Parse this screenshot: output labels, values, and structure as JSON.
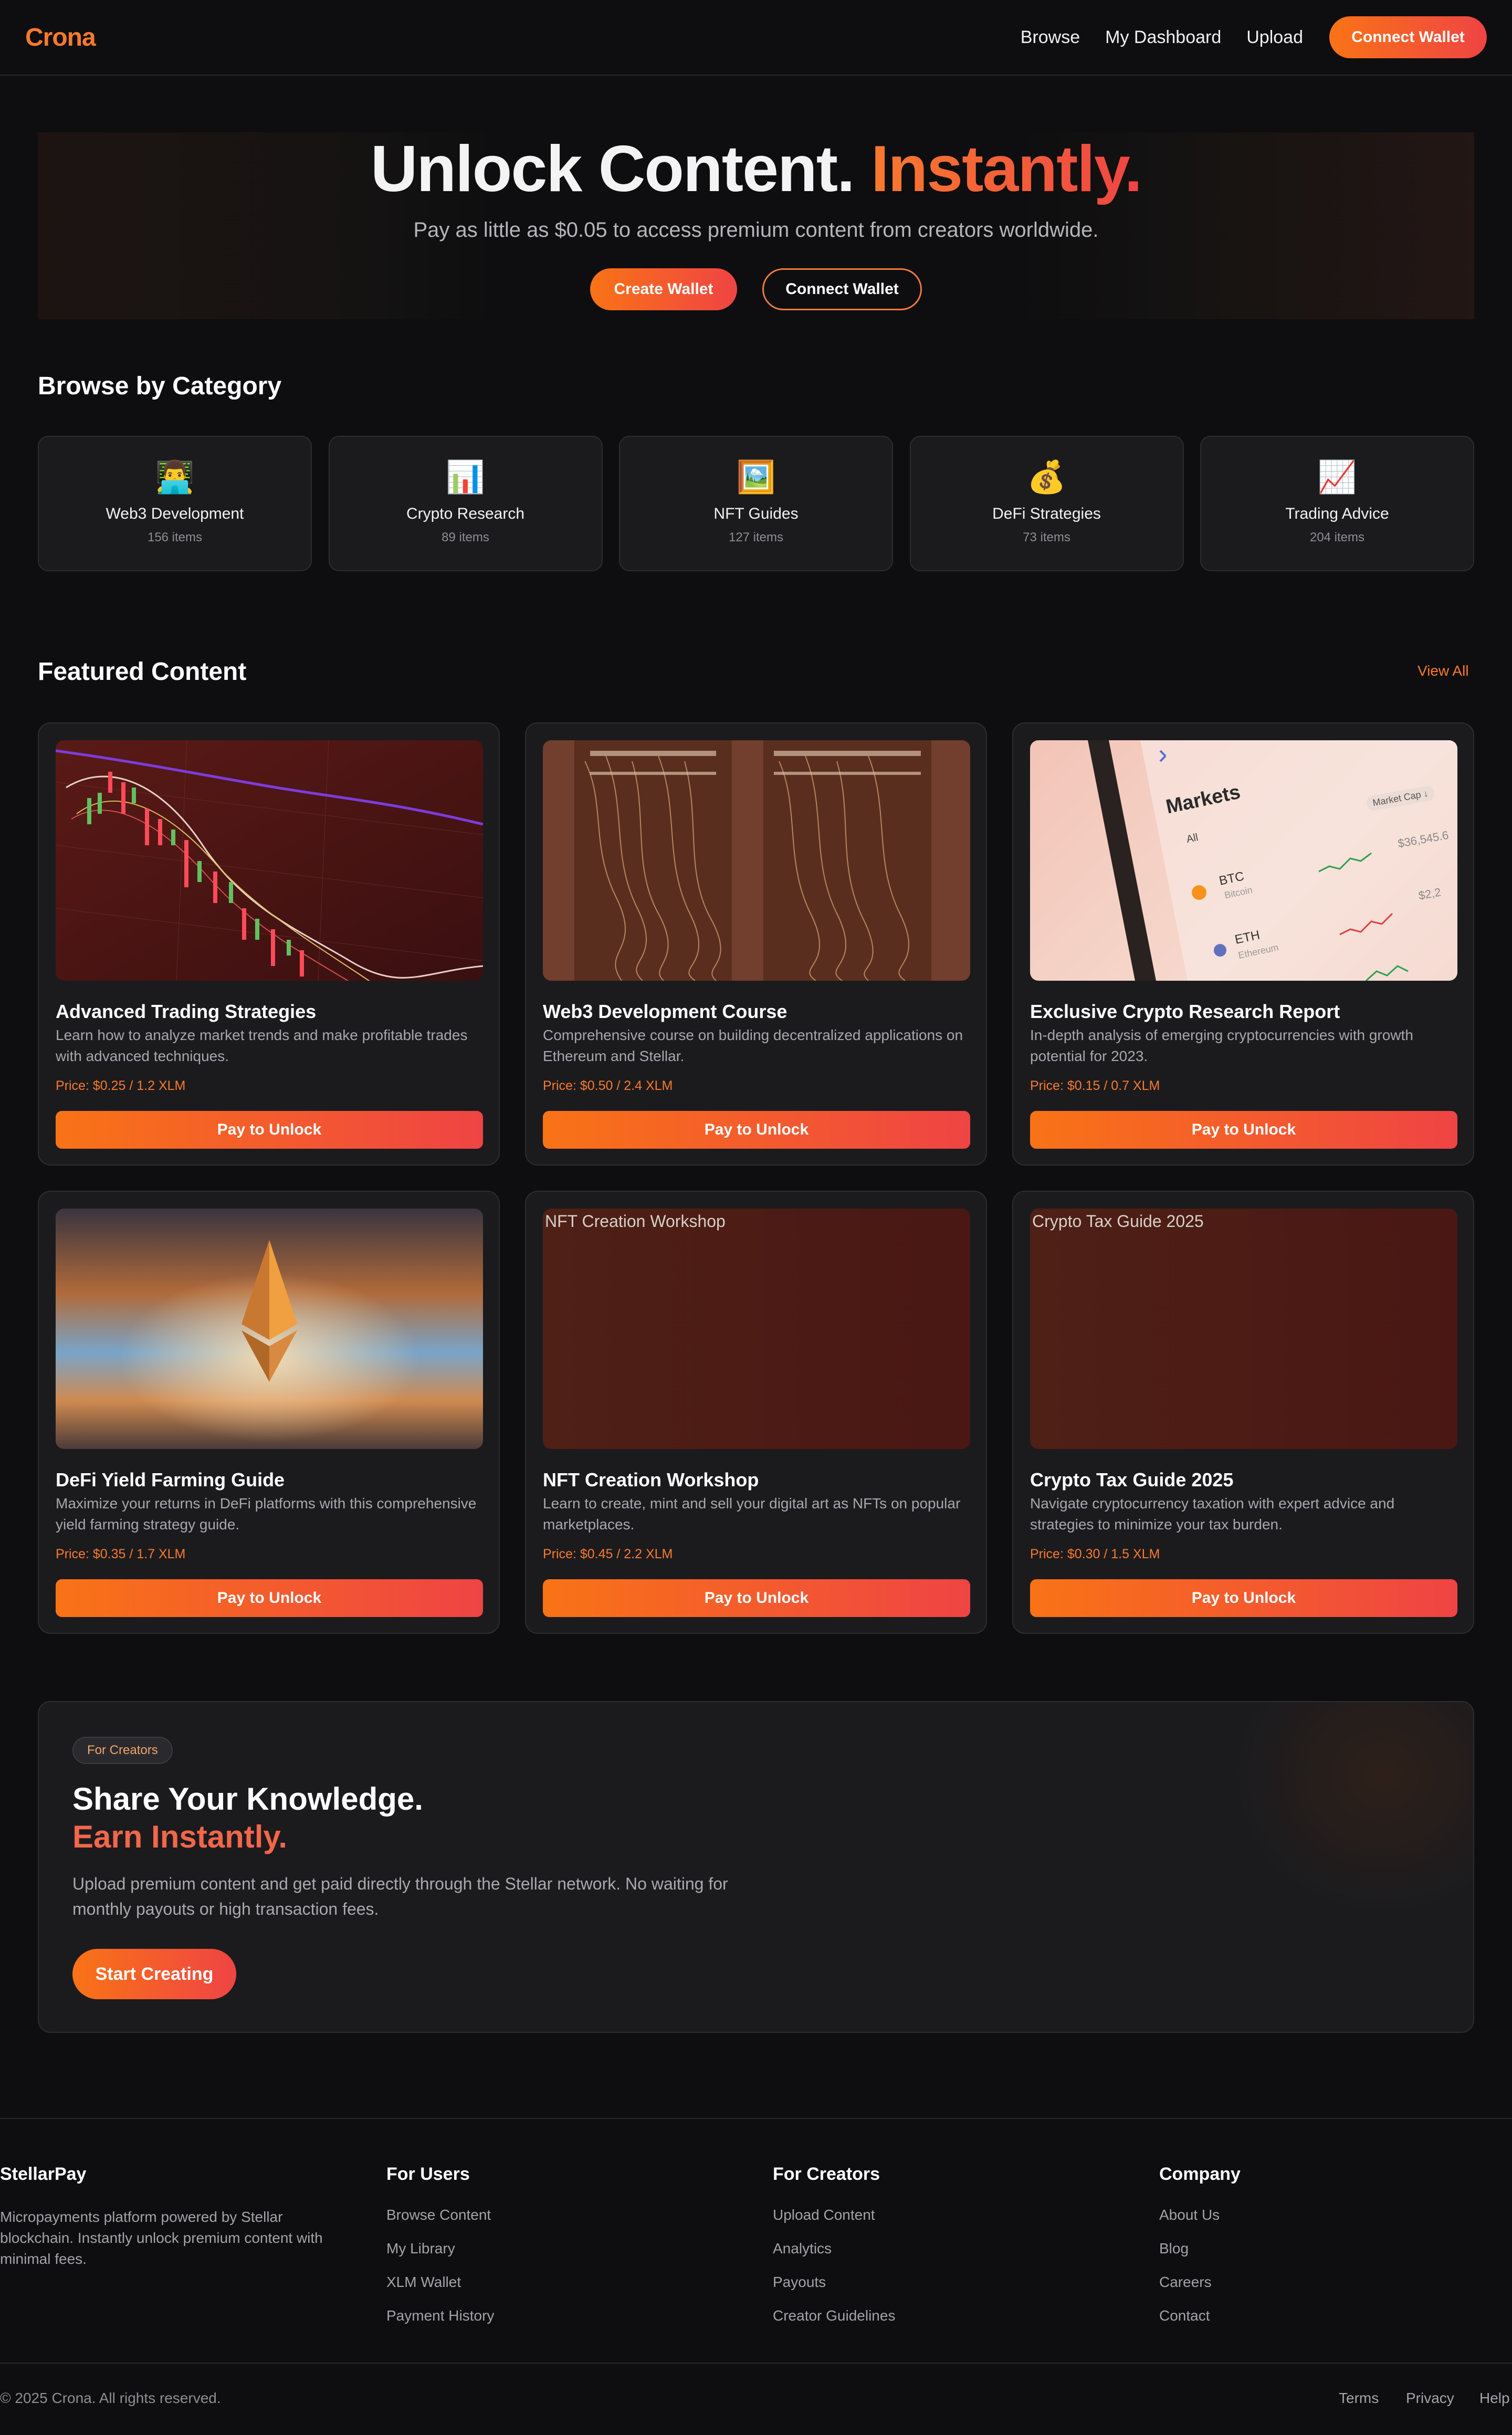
{
  "nav": {
    "logo": "Crona",
    "links": [
      "Browse",
      "My Dashboard",
      "Upload"
    ],
    "connect_button": "Connect Wallet"
  },
  "hero": {
    "title_main": "Unlock Content.",
    "title_accent": "Instantly.",
    "subtitle": "Pay as little as $0.05 to access premium content from creators worldwide.",
    "primary_button": "Create Wallet",
    "secondary_button": "Connect Wallet"
  },
  "categories": {
    "title": "Browse by Category",
    "items": [
      {
        "icon": "👨‍💻",
        "icon_name": "developer-icon",
        "name": "Web3 Development",
        "count": "156 items"
      },
      {
        "icon": "📊",
        "icon_name": "bar-chart-icon",
        "name": "Crypto Research",
        "count": "89 items"
      },
      {
        "icon": "🖼️",
        "icon_name": "framed-picture-icon",
        "name": "NFT Guides",
        "count": "127 items"
      },
      {
        "icon": "💰",
        "icon_name": "money-bag-icon",
        "name": "DeFi Strategies",
        "count": "73 items"
      },
      {
        "icon": "📈",
        "icon_name": "trending-up-icon",
        "name": "Trading Advice",
        "count": "204 items"
      }
    ]
  },
  "featured": {
    "title": "Featured Content",
    "view_all": "View All",
    "cards": [
      {
        "title": "Advanced Trading Strategies",
        "desc": "Learn how to analyze market trends and make profitable trades with advanced techniques.",
        "price": "Price: $0.25 / 1.2 XLM",
        "button": "Pay to Unlock",
        "image": "candlestick-chart-image"
      },
      {
        "title": "Web3 Development Course",
        "desc": "Comprehensive course on building decentralized applications on Ethereum and Stellar.",
        "price": "Price: $0.50 / 2.4 XLM",
        "button": "Pay to Unlock",
        "image": "server-cables-image"
      },
      {
        "title": "Exclusive Crypto Research Report",
        "desc": "In-depth analysis of emerging cryptocurrencies with growth potential for 2023.",
        "price": "Price: $0.15 / 0.7 XLM",
        "button": "Pay to Unlock",
        "image": "phone-markets-image"
      },
      {
        "title": "DeFi Yield Farming Guide",
        "desc": "Maximize your returns in DeFi platforms with this comprehensive yield farming strategy guide.",
        "price": "Price: $0.35 / 1.7 XLM",
        "button": "Pay to Unlock",
        "image": "ethereum-logo-image"
      },
      {
        "title": "NFT Creation Workshop",
        "desc": "Learn to create, mint and sell your digital art as NFTs on popular marketplaces.",
        "price": "Price: $0.45 / 2.2 XLM",
        "button": "Pay to Unlock",
        "image_alt": "NFT Creation Workshop"
      },
      {
        "title": "Crypto Tax Guide 2025",
        "desc": "Navigate cryptocurrency taxation with expert advice and strategies to minimize your tax burden.",
        "price": "Price: $0.30 / 1.5 XLM",
        "button": "Pay to Unlock",
        "image_alt": "Crypto Tax Guide 2025"
      }
    ],
    "phone_screen": {
      "header": "Markets",
      "market_cap": "Market Cap ↓",
      "tab_all": "All",
      "rows": [
        {
          "symbol": "BTC",
          "name": "Bitcoin",
          "price": "$36,545.6"
        },
        {
          "symbol": "ETH",
          "name": "Ethereum",
          "price": "$2,2"
        }
      ]
    }
  },
  "creators": {
    "badge": "For Creators",
    "title_line1": "Share Your Knowledge.",
    "title_line2": "Earn Instantly.",
    "desc": "Upload premium content and get paid directly through the Stellar network. No waiting for monthly payouts or high transaction fees.",
    "button": "Start Creating"
  },
  "footer": {
    "brand": "StellarPay",
    "brand_desc": "Micropayments platform powered by Stellar blockchain. Instantly unlock premium content with minimal fees.",
    "columns": [
      {
        "title": "For Users",
        "links": [
          "Browse Content",
          "My Library",
          "XLM Wallet",
          "Payment History"
        ]
      },
      {
        "title": "For Creators",
        "links": [
          "Upload Content",
          "Analytics",
          "Payouts",
          "Creator Guidelines"
        ]
      },
      {
        "title": "Company",
        "links": [
          "About Us",
          "Blog",
          "Careers",
          "Contact"
        ]
      }
    ],
    "copyright": "© 2025 Crona. All rights reserved.",
    "legal": [
      "Terms",
      "Privacy",
      "Help"
    ]
  },
  "colors": {
    "accent_orange": "#f97316",
    "accent_red": "#ef4444",
    "background": "#0e0e10",
    "card": "#1b1b1e"
  }
}
